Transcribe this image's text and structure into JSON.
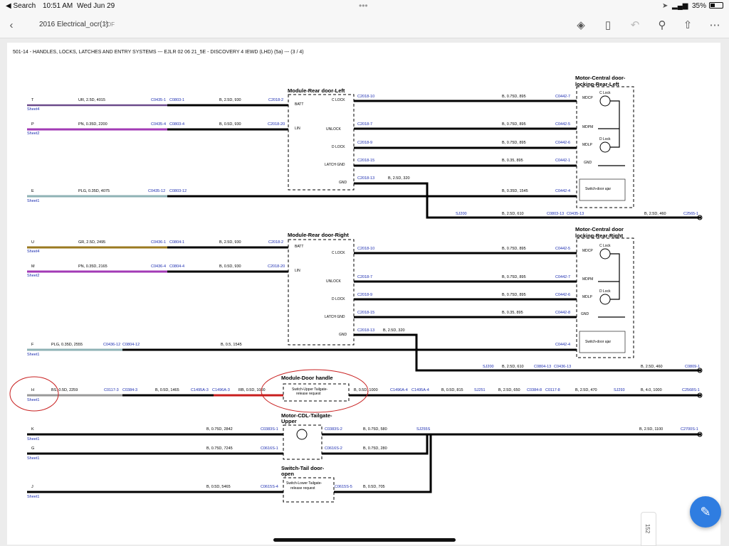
{
  "status": {
    "back_app": "◀ Search",
    "time": "10:51 AM",
    "date": "Wed Jun 29",
    "battery": "35%",
    "dots": "•••"
  },
  "toolbar": {
    "back_icon": "chevron-left-icon",
    "title": "2016 Electrical_ocr(1)",
    "type": "PDF"
  },
  "page": {
    "header": "501-14 - HANDLES, LOCKS, LATCHES AND ENTRY SYSTEMS --- EJLR 02 06 21_5E - DISCOVERY 4 IEWD (LHD) (5a) --- (3 / 4)",
    "page_number": "152"
  },
  "diagram": {
    "modules": {
      "rear_left": "Module-Rear door-Left",
      "rear_right": "Module-Rear door-Right",
      "door_handle": "Module-Door handle",
      "cdl_tailgate_1": "Motor-CDL-Tailgate-",
      "cdl_tailgate_2": "Upper",
      "tail_door_1": "Switch-Tail door-",
      "tail_door_2": "open",
      "motor_rl_1": "Motor-Central door-",
      "motor_rl_2": "locking-Rear-Left",
      "motor_rr_1": "Motor-Central door",
      "motor_rr_2": "locking-Rear-Right",
      "switch_ajar": "Switch-door ajar",
      "switch_upper_1": "Switch-Upper Tailgate-",
      "switch_upper_2": "release request",
      "switch_lower_1": "Switch-Lower Tailgate-",
      "switch_lower_2": "release request",
      "c_lock_motor": "C Lock",
      "d_lock_motor": "D Lock"
    },
    "pins": {
      "batt": "BATT",
      "lin": "LIN",
      "c_lock": "C LOCK",
      "unlock": "UNLOCK",
      "d_lock": "D LOCK",
      "latch_gnd": "LATCH GND",
      "gnd": "GND",
      "mdcp": "MDCP",
      "mdpm": "MDPM",
      "mdlp": "MDLP",
      "gnd_motor": "GND"
    },
    "sheet": {
      "s1": "Sheet1",
      "s2": "Sheet2",
      "s4": "Sheet4"
    },
    "sec1": {
      "T": "T",
      "P": "P",
      "E": "E",
      "w_t": "UR, 2.5D, 4015",
      "c_t1": "C0435-1",
      "c_t2": "C0803-1",
      "w_t2": "B, 2.5D, 930",
      "c_t3": "C2018-2",
      "w_p": "PN, 0.35D, 2200",
      "c_p1": "C0435-4",
      "c_p2": "C0803-4",
      "w_p2": "B, 0.5D, 930",
      "c_p3": "C2018-20",
      "w_e": "PLG, 0.35D, 4075",
      "c_e1": "C0435-12",
      "c_e2": "C0803-12",
      "o1": "C2018-10",
      "o2": "C2018-7",
      "o3": "C2018-9",
      "o4": "C2018-15",
      "o5": "C2018-13",
      "ow1": "B, 0.75D, 895",
      "ow2": "B, 0.75D, 895",
      "ow3": "B, 0.75D, 895",
      "ow4": "B, 0.35, 895",
      "ow5": "B, 0.35D, 1545",
      "gw": "B, 2.5D, 320",
      "m1": "C0442-7",
      "m2": "C0442-5",
      "m3": "C0442-6",
      "m4": "C0442-1",
      "m5": "C0442-4",
      "sj": "SJ200",
      "sjw": "B, 2.5D, 610",
      "sjc1": "C0803-13",
      "sjc2": "C0435-13",
      "sjw2": "B, 2.5D, 460",
      "sjend": "C2565-1"
    },
    "sec2": {
      "U": "U",
      "M": "M",
      "F": "F",
      "w_u": "GR, 2.5D, 2495",
      "c_u1": "C0436-1",
      "c_u2": "C0804-1",
      "w_u2": "B, 2.5D, 930",
      "c_u3": "C2018-2",
      "w_m": "PN, 0.35D, 2165",
      "c_m1": "C0436-4",
      "c_m2": "C0804-4",
      "w_m2": "B, 0.5D, 930",
      "c_m3": "C2018-20",
      "w_f": "PLG, 0.35D, 2555",
      "c_f1": "C0436-12",
      "c_f2": "C0804-12",
      "w_f2": "B, 0.5, 1545",
      "o1": "C2018-10",
      "o2": "C2018-7",
      "o3": "C2018-9",
      "o4": "C2018-15",
      "o5": "C2018-13",
      "ow1": "B, 0.75D, 895",
      "ow2": "B, 0.75D, 895",
      "ow3": "B, 0.75D, 895",
      "ow4": "B, 0.35, 895",
      "gw": "B, 2.5D, 320",
      "m1": "C0442-5",
      "m2": "C0442-7",
      "m3": "C0442-6",
      "m4": "C0442-8",
      "m5": "C0442-4",
      "sj": "SJ200",
      "sjw": "B, 2.5D, 610",
      "sjc1": "C0804-13",
      "sjc2": "C0436-13",
      "sjw2": "B, 2.5D, 460",
      "sjend": "C0809-1"
    },
    "sec3": {
      "H": "H",
      "K": "K",
      "G": "G",
      "J": "J",
      "w_h1": "BS, 0.5D, 2259",
      "c_h1": "C0117-3",
      "c_h2": "C0384-3",
      "w_h2": "B, 0.5D, 1465",
      "c_h3": "C1495A-3",
      "c_h4": "C1496A-3",
      "w_h3": "RB, 0.5D, 1000",
      "w_h4": "B, 0.5D, 1000",
      "c_h5": "C1496A-4",
      "c_h6": "C1495A-4",
      "w_h5": "B, 0.5D, 815",
      "sj1": "SJ251",
      "w_h6": "B, 2.5D, 650",
      "c_h7": "C0384-8",
      "c_h8": "C0117-8",
      "w_h7": "B, 2.5D, 470",
      "sj2": "SJ293",
      "w_h8": "B, 4.0, 1000",
      "c_hend": "C2568S-1",
      "w_k": "B, 0.75D, 2842",
      "c_k1": "C0383S-1",
      "c_k2": "C0383S-2",
      "w_k2": "B, 0.75D, 580",
      "sj3": "SJ255S",
      "w_k3": "B, 2.5D, 1100",
      "c_kend": "C2700S-1",
      "w_g": "B, 0.75D, 7245",
      "c_g1": "C0616S-1",
      "c_g2": "C0616S-2",
      "w_g2": "B, 0.75D, 280",
      "w_j": "B, 0.5D, 5465",
      "c_j1": "C0615S-4",
      "c_j2": "C0615S-5",
      "w_j2": "B, 0.5D, 705"
    }
  }
}
